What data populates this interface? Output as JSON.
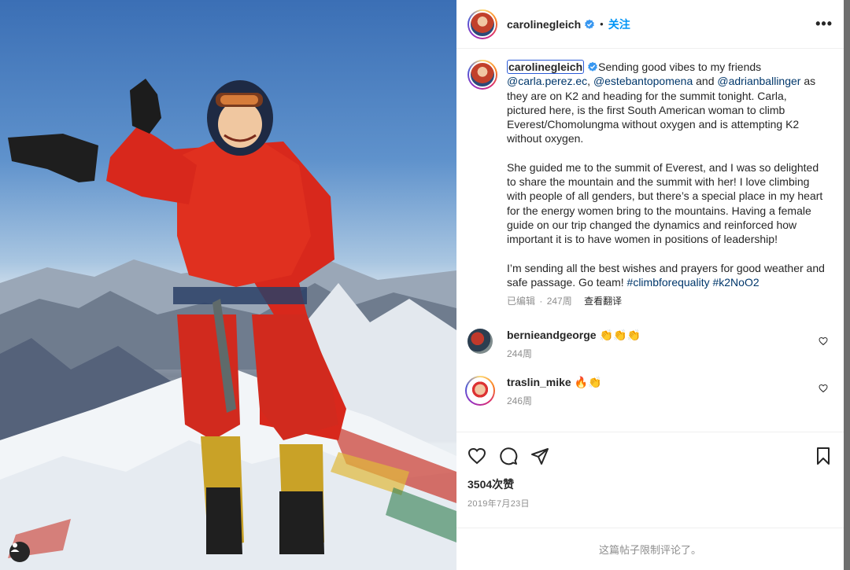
{
  "post": {
    "username": "carolinegleich",
    "follow_label": "关注",
    "dot": "•",
    "more_label": "•••"
  },
  "caption": {
    "username": "carolinegleich",
    "p1_text1": "Sending good vibes to my friends ",
    "mention1": "@carla.perez.ec",
    "p1_sep1": ", ",
    "mention2": "@estebantopomena",
    "p1_and": " and ",
    "mention3": "@adrianballinger",
    "p1_text2": " as they are on K2 and heading for the summit tonight. Carla, pictured here, is the first South American woman to climb Everest/Chomolungma without oxygen and is attempting K2 without oxygen.",
    "p2": "She guided me to the summit of Everest, and I was so delighted to share the mountain and the summit with her! I love climbing with people of all genders, but there’s a special place in my heart for the energy women bring to the mountains. Having a female guide on our trip changed the dynamics and reinforced how important it is to have women in positions of leadership!",
    "p3_text": "I’m sending all the best wishes and prayers for good weather and safe passage. Go team! ",
    "hashtag1": "#climbforequality",
    "hashtag2": "#k2NoO2",
    "edited": "已编辑",
    "sep": "·",
    "weeks": "247周",
    "translate": "查看翻译"
  },
  "comments": [
    {
      "username": "bernieandgeorge",
      "emoji": "👏👏👏",
      "time": "244周"
    },
    {
      "username": "traslin_mike",
      "emoji": "🔥👏",
      "time": "246周"
    }
  ],
  "actions": {
    "likes": "3504次赞",
    "date": "2019年7月23日"
  },
  "footer": {
    "restricted": "这篇帖子限制评论了。"
  },
  "colors": {
    "link": "#00376b",
    "accent": "#0095f6",
    "jacket": "#d8281c"
  },
  "icons": [
    "verified-badge-icon",
    "more-options-icon",
    "heart-icon",
    "comment-icon",
    "share-icon",
    "bookmark-icon",
    "user-tag-icon"
  ]
}
